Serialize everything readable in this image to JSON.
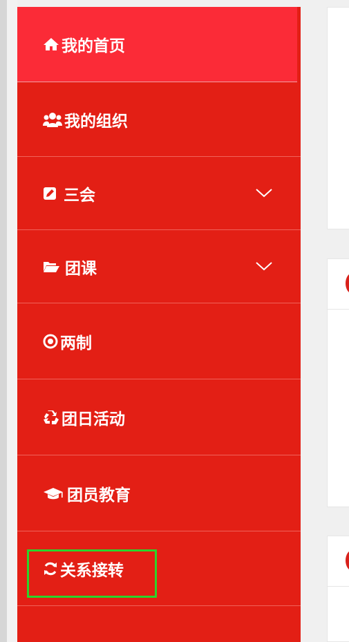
{
  "sidebar": {
    "items": [
      {
        "label": "我的首页",
        "icon": "home-icon",
        "active": true,
        "expandable": false
      },
      {
        "label": "我的组织",
        "icon": "users-icon",
        "active": false,
        "expandable": false
      },
      {
        "label": "三会",
        "icon": "edit-icon",
        "active": false,
        "expandable": true
      },
      {
        "label": "团课",
        "icon": "folder-open-icon",
        "active": false,
        "expandable": true
      },
      {
        "label": "两制",
        "icon": "dot-circle-icon",
        "active": false,
        "expandable": false
      },
      {
        "label": "团日活动",
        "icon": "recycle-icon",
        "active": false,
        "expandable": false
      },
      {
        "label": "团员教育",
        "icon": "graduation-cap-icon",
        "active": false,
        "expandable": false
      },
      {
        "label": "关系接转",
        "icon": "refresh-icon",
        "active": false,
        "expandable": false,
        "highlighted": true
      }
    ]
  },
  "colors": {
    "sidebar_bg": "#e31f15",
    "active_bg": "#fb2b37",
    "highlight": "#2bd42b",
    "text": "#ffffff"
  }
}
